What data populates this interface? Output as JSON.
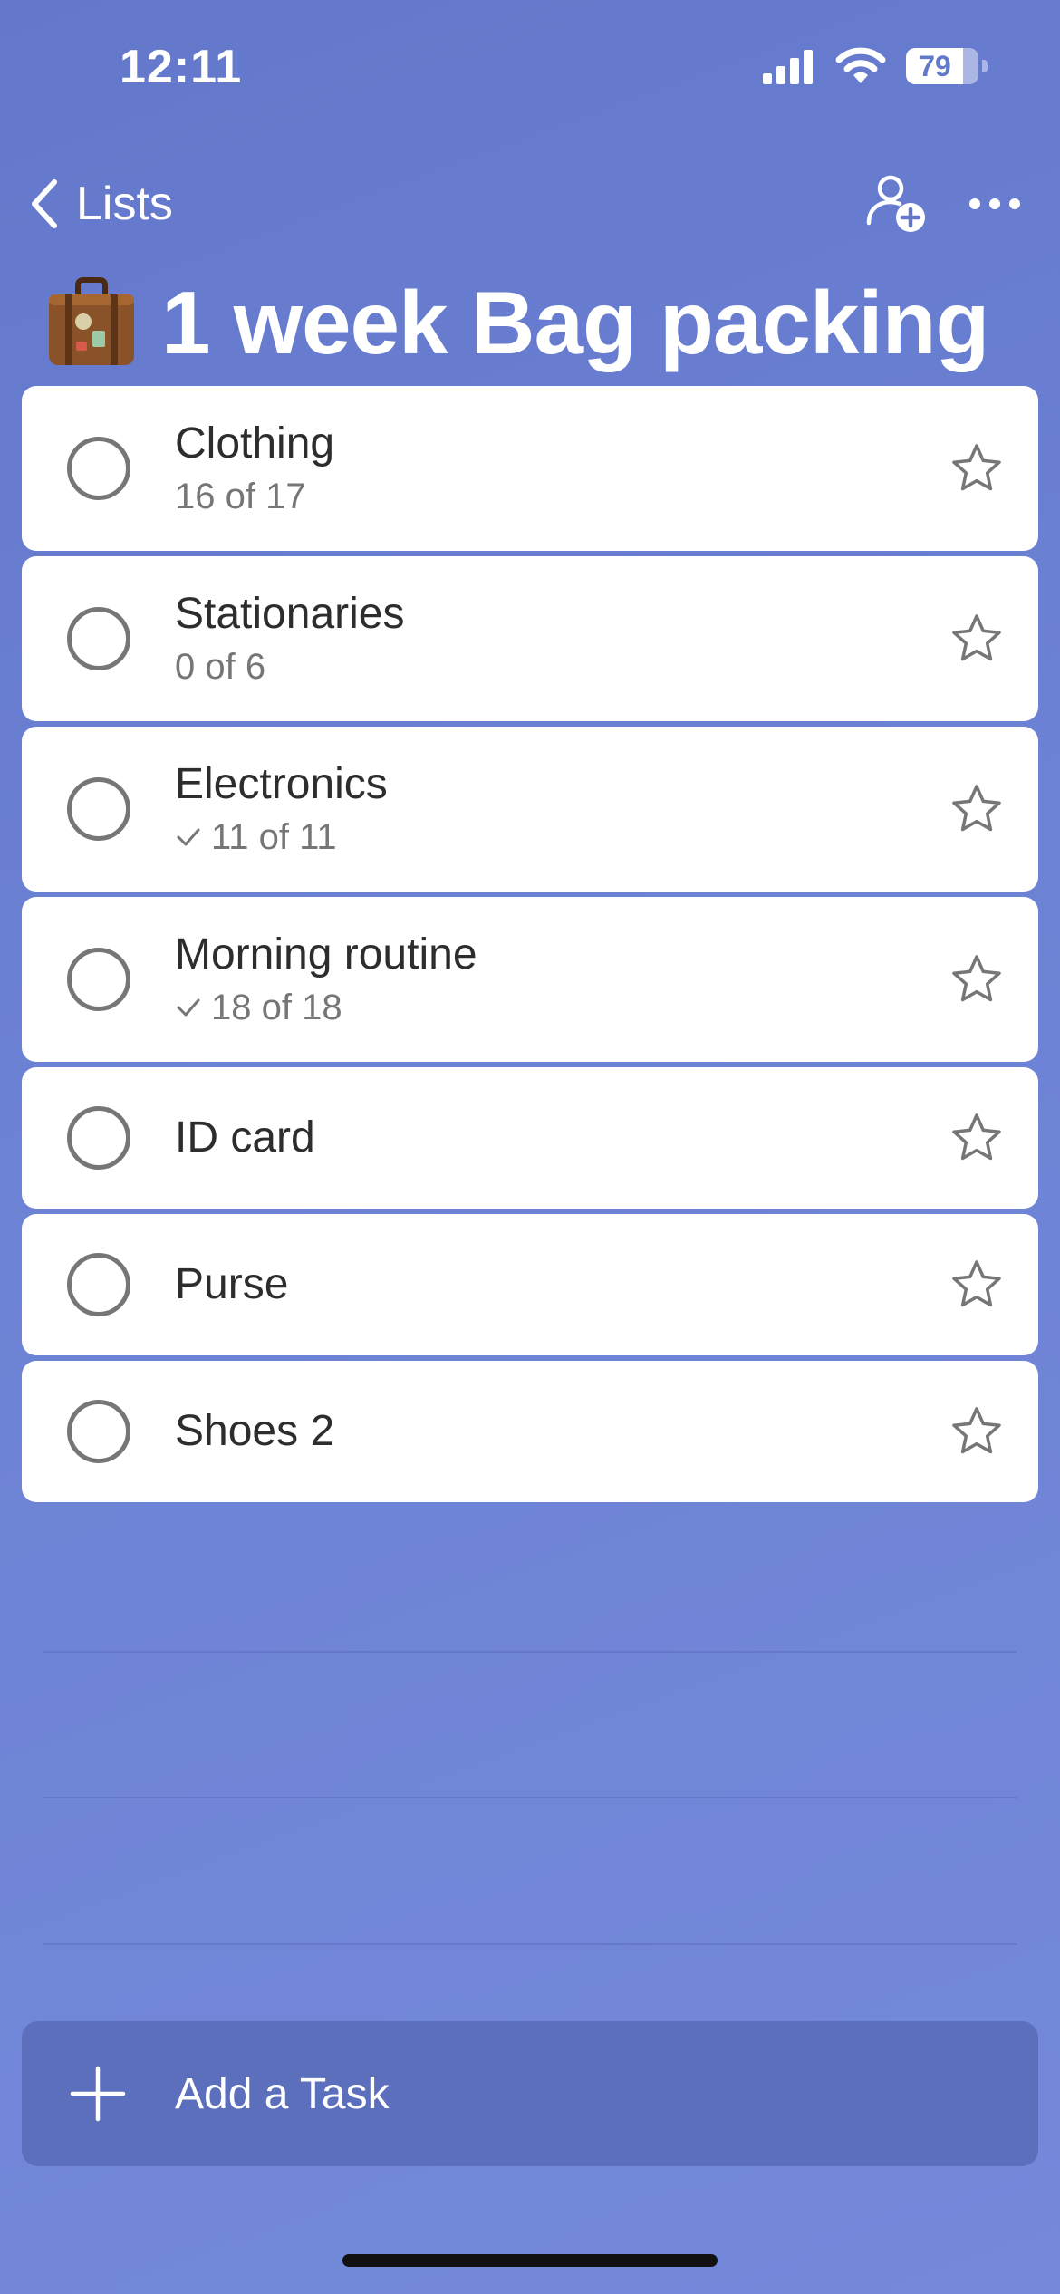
{
  "status_bar": {
    "time": "12:11",
    "battery_level": "79",
    "battery_fraction": 0.79
  },
  "nav": {
    "back_label": "Lists",
    "back_icon": "chevron-left-icon",
    "share_icon": "add-person-icon",
    "more_icon": "ellipsis-icon"
  },
  "list": {
    "icon": "suitcase-icon",
    "title": "1 week Bag packing"
  },
  "tasks": [
    {
      "title": "Clothing",
      "subtitle": "16 of 17",
      "completed_steps": false
    },
    {
      "title": "Stationaries",
      "subtitle": "0 of 6",
      "completed_steps": false
    },
    {
      "title": "Electronics",
      "subtitle": "11 of 11",
      "completed_steps": true
    },
    {
      "title": "Morning routine",
      "subtitle": "18 of 18",
      "completed_steps": true
    },
    {
      "title": "ID card"
    },
    {
      "title": "Purse"
    },
    {
      "title": "Shoes 2"
    }
  ],
  "add_task": {
    "label": "Add a Task",
    "icon": "plus-icon"
  },
  "colors": {
    "background": "#6c82d4",
    "card": "#ffffff",
    "add_bar": "#5b6fbd",
    "text_primary": "#2d2d2d",
    "text_secondary": "#767676"
  }
}
